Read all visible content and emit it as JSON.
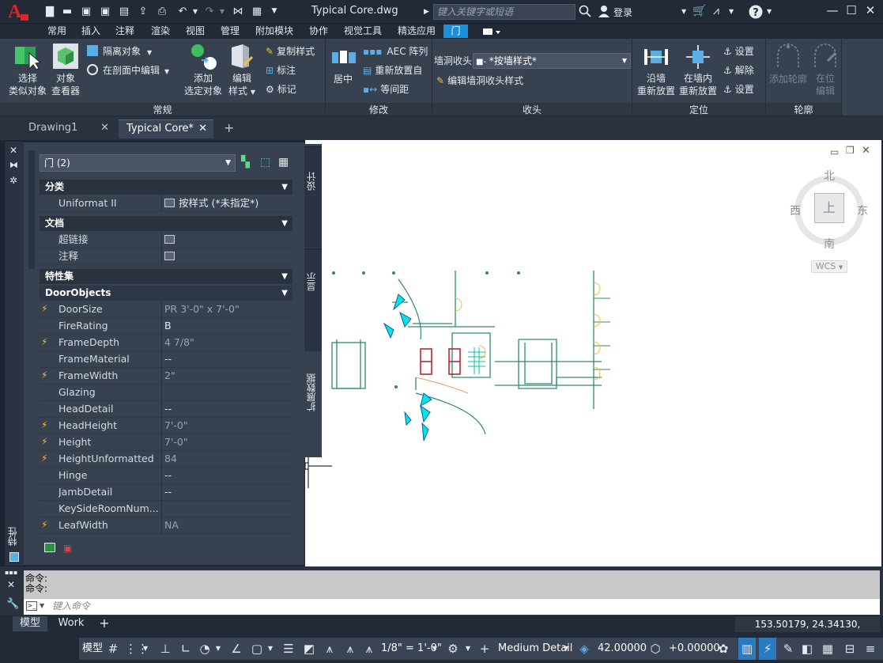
{
  "app": {
    "title": "Typical Core.dwg",
    "logo_letter": "A"
  },
  "search": {
    "placeholder": "键入关键字或短语"
  },
  "user": {
    "login": "登录"
  },
  "ribbon_tabs": [
    "常用",
    "插入",
    "注释",
    "渲染",
    "视图",
    "管理",
    "附加模块",
    "协作",
    "视觉工具",
    "精选应用",
    "门"
  ],
  "ribbon": {
    "general": {
      "title": "常规",
      "select_similar": [
        "选择",
        "类似对象"
      ],
      "object_viewer": [
        "对象",
        "查看器"
      ],
      "isolate": "隔离对象",
      "edit_in_section": "在剖面中编辑",
      "add_selected": [
        "添加",
        "选定对象"
      ],
      "edit_style": [
        "编辑",
        "样式"
      ],
      "copy_style": "复制样式",
      "dimension": "标注",
      "tag": "标记"
    },
    "modify": {
      "title": "修改",
      "center": "居中",
      "aec_array": "AEC 阵列",
      "reposition_from": "重新放置自",
      "equal_spacing": "等间距"
    },
    "endcap": {
      "title": "收头",
      "label": "墙洞收头",
      "style_value": "*按墙样式*",
      "edit_style": "编辑墙洞收头样式"
    },
    "location": {
      "title": "定位",
      "along_wall": [
        "沿墙",
        "重新放置"
      ],
      "within_wall": [
        "在墙内",
        "重新放置"
      ],
      "settings1": "设置",
      "release": "解除",
      "settings2": "设置"
    },
    "profile": {
      "title": "轮廓",
      "add_profile": "添加轮廓",
      "edit_in_place": [
        "在位",
        "编辑"
      ]
    }
  },
  "doc_tabs": [
    "Drawing1",
    "Typical Core*"
  ],
  "properties": {
    "selection": "门 (2)",
    "side_tabs": [
      "设计",
      "显示",
      "扩展数据"
    ],
    "palette_label": "特性",
    "categories": {
      "classification": "分类",
      "documents": "文档",
      "property_sets": "特性集",
      "door_objects": "DoorObjects"
    },
    "classification_rows": [
      {
        "name": "Uniformat II",
        "value": "按样式 (*未指定*)"
      }
    ],
    "document_rows": [
      {
        "name": "超链接",
        "value": ""
      },
      {
        "name": "注释",
        "value": ""
      }
    ],
    "door_rows": [
      {
        "name": "DoorSize",
        "value": "PR 3'-0\" x 7'-0\"",
        "auto": true
      },
      {
        "name": "FireRating",
        "value": "B",
        "auto": false
      },
      {
        "name": "FrameDepth",
        "value": "4 7/8\"",
        "auto": true
      },
      {
        "name": "FrameMaterial",
        "value": "--",
        "auto": false
      },
      {
        "name": "FrameWidth",
        "value": "2\"",
        "auto": true
      },
      {
        "name": "Glazing",
        "value": "",
        "auto": false
      },
      {
        "name": "HeadDetail",
        "value": "--",
        "auto": false
      },
      {
        "name": "HeadHeight",
        "value": "7'-0\"",
        "auto": true
      },
      {
        "name": "Height",
        "value": "7'-0\"",
        "auto": true
      },
      {
        "name": "HeightUnformatted",
        "value": "84",
        "auto": true
      },
      {
        "name": "Hinge",
        "value": "--",
        "auto": false
      },
      {
        "name": "JambDetail",
        "value": "--",
        "auto": false
      },
      {
        "name": "KeySideRoomNum...",
        "value": "",
        "auto": false
      },
      {
        "name": "LeafWidth",
        "value": "NA",
        "auto": true
      }
    ]
  },
  "viewcube": {
    "north": "北",
    "south": "南",
    "east": "东",
    "west": "西",
    "top": "上",
    "wcs": "WCS"
  },
  "command": {
    "history": [
      "命令:",
      "命令:"
    ],
    "placeholder": "键入命令"
  },
  "layout_tabs": [
    "模型",
    "Work"
  ],
  "coords": "153.50179, 24.34130, 0.00000",
  "status": {
    "model": "模型",
    "scale": "1/8\" = 1'-0\"",
    "detail": "Medium Detail",
    "elevation": "42.00000",
    "offset": "+0.00000"
  }
}
